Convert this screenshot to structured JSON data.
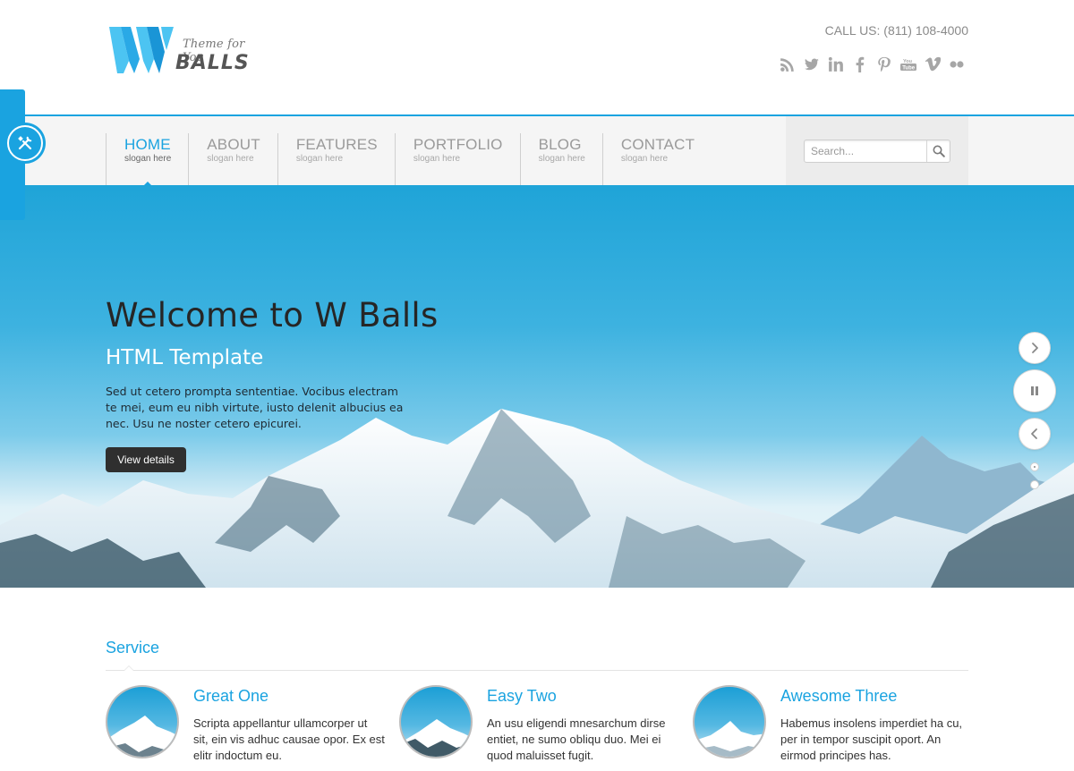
{
  "header": {
    "logo_letter": "W",
    "logo_tagline": "Theme for You",
    "logo_name": "BALLS",
    "call_us": "CALL US: (811) 108-4000",
    "social": [
      "rss-icon",
      "twitter-icon",
      "linkedin-icon",
      "facebook-icon",
      "pinterest-icon",
      "youtube-icon",
      "vimeo-icon",
      "flickr-icon"
    ]
  },
  "nav": {
    "items": [
      {
        "label": "HOME",
        "slogan": "slogan here"
      },
      {
        "label": "ABOUT",
        "slogan": "slogan here"
      },
      {
        "label": "FEATURES",
        "slogan": "slogan here"
      },
      {
        "label": "PORTFOLIO",
        "slogan": "slogan here"
      },
      {
        "label": "BLOG",
        "slogan": "slogan here"
      },
      {
        "label": "CONTACT",
        "slogan": "slogan here"
      }
    ],
    "active_index": 0
  },
  "search": {
    "placeholder": "Search..."
  },
  "hero": {
    "title": "Welcome to W Balls",
    "subtitle": "HTML Template",
    "text": "Sed ut cetero prompta sententiae. Vocibus electram te mei, eum eu nibh virtute, iusto delenit albucius ea nec. Usu ne noster cetero epicurei.",
    "button": "View details",
    "slide_count": 2,
    "active_slide": 0
  },
  "services": {
    "title": "Service",
    "items": [
      {
        "title": "Great One",
        "text": "Scripta appellantur ullamcorper ut sit, ein vis adhuc causae opor. Ex est elitr indoctum eu."
      },
      {
        "title": "Easy Two",
        "text": "An usu eligendi mnesarchum dirse entiet, ne sumo obliqu duo. Mei ei quod maluisset fugit."
      },
      {
        "title": "Awesome Three",
        "text": "Habemus insolens imperdiet ha cu, per in tempor suscipit oport. An eirmod principes has."
      }
    ]
  },
  "colors": {
    "accent": "#1aa3e0",
    "dark_button": "#2f2f2f",
    "nav_bg": "#f5f5f5"
  }
}
